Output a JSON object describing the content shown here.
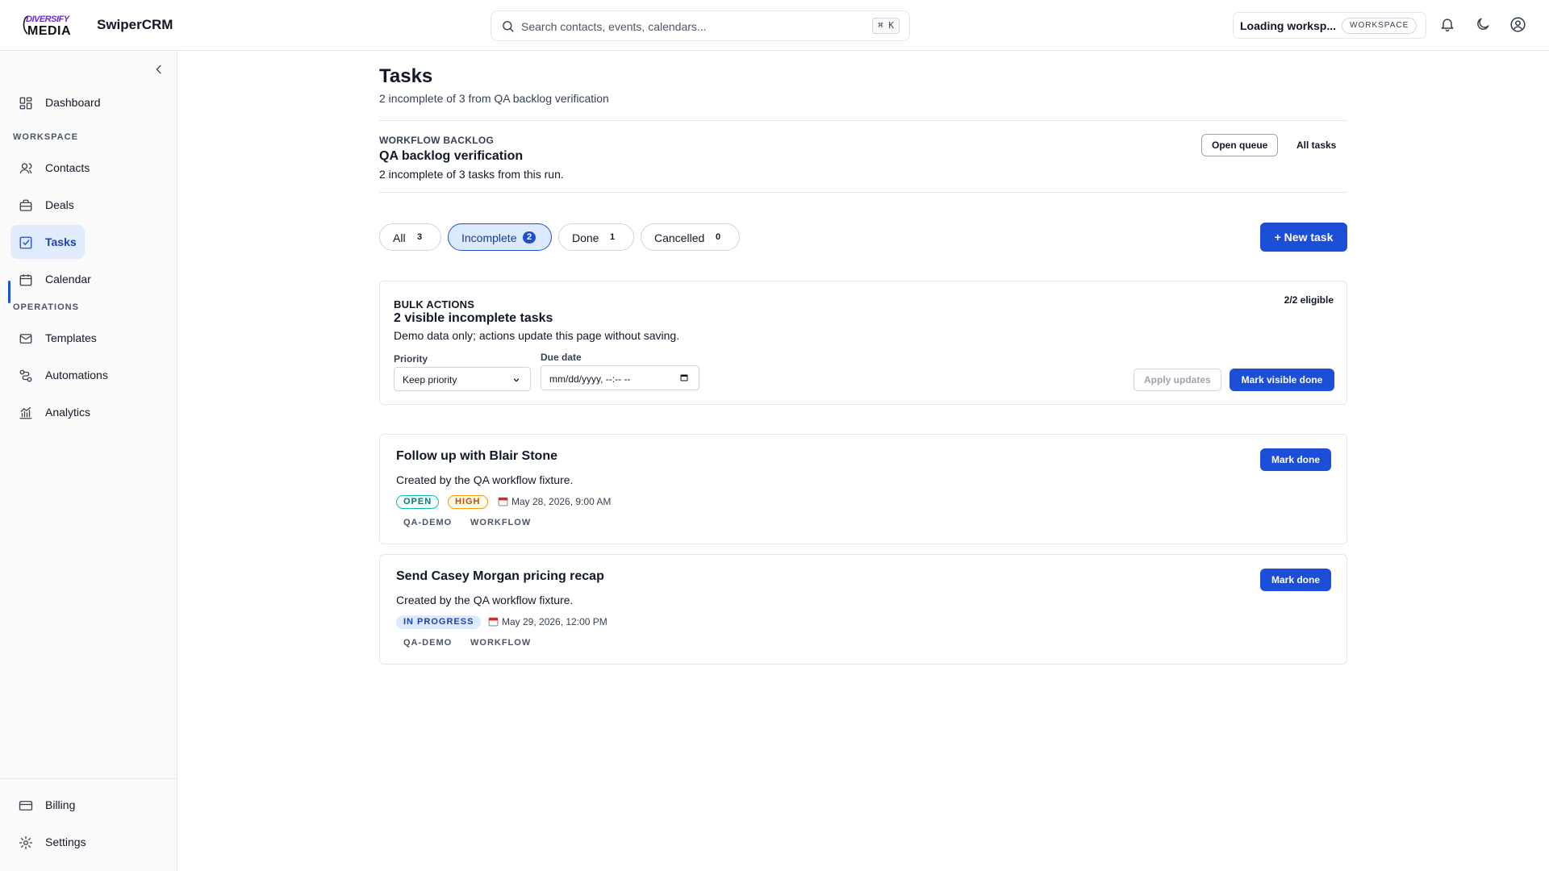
{
  "header": {
    "logo_line1": "DIVERSIFY",
    "logo_line2": "MEDIA",
    "brand": "SwiperCRM",
    "search_placeholder": "Search contacts, events, calendars...",
    "search_shortcut": "⌘ K",
    "workspace_name": "Loading worksp...",
    "workspace_badge": "WORKSPACE"
  },
  "sidebar": {
    "dashboard": "Dashboard",
    "section_workspace": "WORKSPACE",
    "contacts": "Contacts",
    "deals": "Deals",
    "tasks": "Tasks",
    "calendar": "Calendar",
    "section_operations": "OPERATIONS",
    "templates": "Templates",
    "automations": "Automations",
    "analytics": "Analytics",
    "billing": "Billing",
    "settings": "Settings"
  },
  "page": {
    "title": "Tasks",
    "subtitle": "2 incomplete of 3 from QA backlog verification"
  },
  "workflow": {
    "label": "WORKFLOW BACKLOG",
    "title": "QA backlog verification",
    "subtitle": "2 incomplete of 3 tasks from this run.",
    "open_queue": "Open queue",
    "all_tasks": "All tasks"
  },
  "filters": [
    {
      "label": "All",
      "count": "3"
    },
    {
      "label": "Incomplete",
      "count": "2"
    },
    {
      "label": "Done",
      "count": "1"
    },
    {
      "label": "Cancelled",
      "count": "0"
    }
  ],
  "new_task": "+ New task",
  "bulk": {
    "label": "BULK ACTIONS",
    "title": "2 visible incomplete tasks",
    "subtitle": "Demo data only; actions update this page without saving.",
    "eligible": "2/2 eligible",
    "priority_label": "Priority",
    "priority_value": "Keep priority",
    "due_label": "Due date",
    "due_value": "mm/dd/yyyy, --:-- --",
    "apply": "Apply updates",
    "mark_visible_done": "Mark visible done"
  },
  "tasks": [
    {
      "title": "Follow up with Blair Stone",
      "desc": "Created by the QA workflow fixture.",
      "status": "OPEN",
      "priority": "HIGH",
      "due": "May 28, 2026, 9:00 AM",
      "tags": [
        "QA-DEMO",
        "WORKFLOW"
      ],
      "action": "Mark done"
    },
    {
      "title": "Send Casey Morgan pricing recap",
      "desc": "Created by the QA workflow fixture.",
      "status": "IN PROGRESS",
      "due": "May 29, 2026, 12:00 PM",
      "tags": [
        "QA-DEMO",
        "WORKFLOW"
      ],
      "action": "Mark done"
    }
  ],
  "colors": {
    "primary": "#1d4ed8",
    "active_nav_bg": "#e0ebfb",
    "open_status": "#0f766e",
    "high_priority": "#b45309"
  },
  "icons": [
    "search-icon",
    "bell-icon",
    "moon-icon",
    "user-circle-icon",
    "chevron-left-icon",
    "dashboard-icon",
    "contacts-icon",
    "deals-icon",
    "tasks-icon",
    "calendar-icon",
    "templates-icon",
    "automations-icon",
    "analytics-icon",
    "billing-icon",
    "settings-icon"
  ]
}
